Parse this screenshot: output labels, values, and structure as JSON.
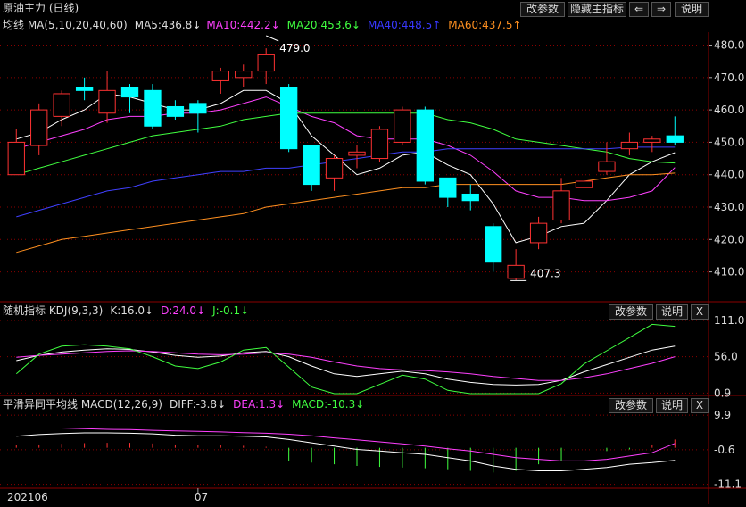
{
  "window": {
    "title": "原油主力 (日线)"
  },
  "toolbar": {
    "edit_params": "改参数",
    "hide_indicator": "隐藏主指标",
    "back": "⇐",
    "forward": "⇒",
    "help": "说明"
  },
  "ma_header": {
    "name": "均线 MA(5,10,20,40,60)",
    "ma5": "MA5:436.8↓",
    "ma10": "MA10:442.2↓",
    "ma20": "MA20:453.6↓",
    "ma40": "MA40:448.5↑",
    "ma60": "MA60:437.5↑"
  },
  "kdj_header": {
    "name": "随机指标 KDJ(9,3,3)",
    "k": "K:16.0↓",
    "d": "D:24.0↓",
    "j": "J:-0.1↓",
    "edit_params": "改参数",
    "help": "说明",
    "close": "X"
  },
  "macd_header": {
    "name": "平滑异同平均线 MACD(12,26,9)",
    "diff": "DIFF:-3.8↓",
    "dea": "DEA:1.3↓",
    "macd": "MACD:-10.3↓",
    "edit_params": "改参数",
    "help": "说明",
    "close": "X"
  },
  "colors": {
    "up": "#ff3232",
    "down": "#00ffff",
    "ma5": "#ffffff",
    "ma10": "#ff40ff",
    "ma20": "#40ff40",
    "ma40": "#4040ff",
    "ma60": "#ff9020",
    "grid": "#8b0000",
    "k": "#ffffff",
    "d": "#ff40ff",
    "j": "#40ff40"
  },
  "chart_data": [
    {
      "type": "candlestick",
      "title": "原油主力 (日线)",
      "ylim": [
        403,
        484
      ],
      "yticks": [
        "480.0",
        "470.0",
        "460.0",
        "450.0",
        "440.0",
        "430.0",
        "420.0",
        "410.0"
      ],
      "annotations": [
        "479.0",
        "407.3"
      ],
      "candles": [
        {
          "o": 440,
          "c": 450,
          "h": 454,
          "l": 440
        },
        {
          "o": 449,
          "c": 460,
          "h": 462,
          "l": 446
        },
        {
          "o": 458,
          "c": 465,
          "h": 466,
          "l": 455
        },
        {
          "o": 467,
          "c": 466,
          "h": 470,
          "l": 463
        },
        {
          "o": 459,
          "c": 466,
          "h": 472,
          "l": 456
        },
        {
          "o": 467,
          "c": 464,
          "h": 468,
          "l": 459
        },
        {
          "o": 466,
          "c": 455,
          "h": 468,
          "l": 454
        },
        {
          "o": 461,
          "c": 458,
          "h": 463,
          "l": 457
        },
        {
          "o": 462,
          "c": 459,
          "h": 463,
          "l": 453
        },
        {
          "o": 469,
          "c": 472,
          "h": 473,
          "l": 465
        },
        {
          "o": 470,
          "c": 472,
          "h": 474,
          "l": 467
        },
        {
          "o": 472,
          "c": 477,
          "h": 479,
          "l": 468
        },
        {
          "o": 467,
          "c": 448,
          "h": 468,
          "l": 447
        },
        {
          "o": 449,
          "c": 437,
          "h": 449,
          "l": 435
        },
        {
          "o": 439,
          "c": 445,
          "h": 446,
          "l": 435
        },
        {
          "o": 446,
          "c": 447,
          "h": 449,
          "l": 442
        },
        {
          "o": 445,
          "c": 454,
          "h": 455,
          "l": 444
        },
        {
          "o": 450,
          "c": 460,
          "h": 461,
          "l": 449
        },
        {
          "o": 460,
          "c": 438,
          "h": 461,
          "l": 437
        },
        {
          "o": 439,
          "c": 433,
          "h": 439,
          "l": 430
        },
        {
          "o": 434,
          "c": 432,
          "h": 437,
          "l": 429
        },
        {
          "o": 424,
          "c": 413,
          "h": 425,
          "l": 410
        },
        {
          "o": 408,
          "c": 412,
          "h": 417,
          "l": 407.3
        },
        {
          "o": 419,
          "c": 425,
          "h": 427,
          "l": 417
        },
        {
          "o": 426,
          "c": 435,
          "h": 439,
          "l": 425
        },
        {
          "o": 436,
          "c": 438,
          "h": 441,
          "l": 435
        },
        {
          "o": 441,
          "c": 444,
          "h": 450,
          "l": 440
        },
        {
          "o": 448,
          "c": 450,
          "h": 453,
          "l": 446
        },
        {
          "o": 450,
          "c": 451,
          "h": 452,
          "l": 447
        },
        {
          "o": 452,
          "c": 450,
          "h": 458,
          "l": 449
        }
      ],
      "series": [
        {
          "name": "MA5",
          "values": [
            451,
            453,
            457,
            460,
            465,
            464,
            462,
            460,
            460,
            462,
            466,
            466,
            462,
            452,
            446,
            440,
            442,
            446,
            447,
            443,
            440,
            431,
            419,
            421,
            424,
            425,
            432,
            440,
            444,
            446.8
          ]
        },
        {
          "name": "MA10",
          "values": [
            448,
            450,
            452,
            454,
            457,
            458,
            458,
            459,
            459,
            460,
            462,
            464,
            461,
            458,
            456,
            452,
            451,
            451,
            451,
            449,
            446,
            441,
            435,
            433,
            433,
            432,
            432,
            433,
            435,
            442.2
          ]
        },
        {
          "name": "MA20",
          "values": [
            440,
            442,
            444,
            446,
            448,
            450,
            452,
            453,
            454,
            455,
            457,
            458,
            459,
            459,
            459,
            459,
            459,
            459,
            459,
            457,
            456,
            454,
            451,
            450,
            449,
            448,
            447,
            445,
            444,
            443.6
          ]
        },
        {
          "name": "MA40",
          "values": [
            427,
            429,
            431,
            433,
            435,
            436,
            438,
            439,
            440,
            441,
            441,
            442,
            442,
            443,
            444,
            445,
            446,
            447,
            447,
            448,
            448,
            448,
            448,
            448,
            448,
            448,
            448,
            448.5,
            448.5,
            448.5
          ]
        },
        {
          "name": "MA60",
          "values": [
            416,
            418,
            420,
            421,
            422,
            423,
            424,
            425,
            426,
            427,
            428,
            430,
            431,
            432,
            433,
            434,
            435,
            436,
            436,
            437,
            437,
            437,
            437,
            437,
            437,
            438,
            439,
            440,
            440,
            440.5
          ]
        }
      ]
    },
    {
      "type": "line",
      "title": "随机指标 KDJ(9,3,3)",
      "ylim": [
        0,
        115
      ],
      "yticks": [
        "111.0",
        "56.0",
        "0.9"
      ],
      "series": [
        {
          "name": "K",
          "values": [
            50,
            58,
            63,
            66,
            68,
            67,
            63,
            58,
            55,
            57,
            62,
            64,
            56,
            42,
            30,
            26,
            30,
            34,
            30,
            22,
            17,
            14,
            13,
            14,
            20,
            33,
            44,
            55,
            66,
            72
          ]
        },
        {
          "name": "D",
          "values": [
            55,
            58,
            60,
            62,
            64,
            65,
            64,
            62,
            60,
            59,
            60,
            62,
            60,
            55,
            48,
            42,
            38,
            36,
            35,
            33,
            30,
            26,
            23,
            20,
            20,
            24,
            30,
            38,
            46,
            56
          ]
        },
        {
          "name": "J",
          "values": [
            30,
            60,
            72,
            74,
            72,
            68,
            56,
            42,
            38,
            48,
            66,
            70,
            40,
            10,
            0,
            0,
            14,
            28,
            22,
            5,
            -5,
            -8,
            -8,
            -5,
            15,
            45,
            65,
            85,
            105,
            102
          ]
        }
      ]
    },
    {
      "type": "bar+line",
      "title": "平滑异同平均线 MACD(12,26,9)",
      "ylim": [
        -12,
        11
      ],
      "yticks": [
        "9.9",
        "-0.6",
        "-11.1"
      ],
      "series": [
        {
          "name": "DIFF",
          "values": [
            3.5,
            4,
            4.3,
            4.5,
            4.5,
            4.4,
            4.2,
            3.8,
            3.6,
            3.6,
            3.5,
            3.3,
            2.5,
            1.5,
            0.5,
            -0.5,
            -1,
            -1.5,
            -2,
            -3,
            -4,
            -5.5,
            -6.5,
            -7,
            -7,
            -6.5,
            -6,
            -5,
            -4.5,
            -3.8
          ]
        },
        {
          "name": "DEA",
          "values": [
            6,
            6,
            6,
            5.8,
            5.6,
            5.5,
            5.3,
            5.1,
            5,
            4.8,
            4.6,
            4.4,
            4.1,
            3.6,
            3,
            2.4,
            1.8,
            1.2,
            0.5,
            -0.3,
            -1,
            -2,
            -3,
            -3.5,
            -4,
            -4,
            -3.5,
            -2.5,
            -1.5,
            1.3
          ]
        },
        {
          "name": "MACD",
          "values": [
            0.8,
            1,
            1.2,
            1.4,
            1.5,
            1.5,
            1.3,
            1,
            0.8,
            0.8,
            0.6,
            0.3,
            -4,
            -4.5,
            -5,
            -5.5,
            -5.8,
            -6,
            -6.2,
            -6.5,
            -7,
            -7.5,
            -7,
            -5,
            -4,
            -2,
            -1,
            -0.5,
            1,
            2.5
          ]
        }
      ],
      "x_tick_labels": [
        "202106",
        "07"
      ]
    }
  ]
}
